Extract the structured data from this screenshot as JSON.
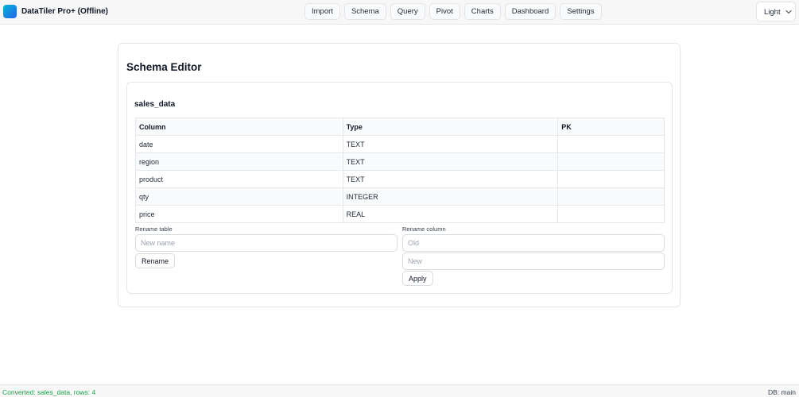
{
  "app": {
    "title": "DataTiler Pro+ (Offline)",
    "logo_icon": "app-logo-icon"
  },
  "nav": {
    "items": [
      "Import",
      "Schema",
      "Query",
      "Pivot",
      "Charts",
      "Dashboard",
      "Settings"
    ]
  },
  "theme_select": {
    "value": "Light",
    "icon": "chevron-down-icon"
  },
  "page": {
    "title": "Schema Editor"
  },
  "table": {
    "name": "sales_data",
    "headers": [
      "Column",
      "Type",
      "PK"
    ],
    "rows": [
      [
        "date",
        "TEXT",
        ""
      ],
      [
        "region",
        "TEXT",
        ""
      ],
      [
        "product",
        "TEXT",
        ""
      ],
      [
        "qty",
        "INTEGER",
        ""
      ],
      [
        "price",
        "REAL",
        ""
      ]
    ]
  },
  "rename_table": {
    "label": "Rename table",
    "placeholder": "New name",
    "value": "",
    "button": "Rename"
  },
  "rename_column": {
    "label": "Rename column",
    "old_placeholder": "Old",
    "new_placeholder": "New",
    "old_value": "",
    "new_value": "",
    "button": "Apply"
  },
  "status": {
    "message": "Converted: sales_data, rows: 4",
    "db": "DB: main"
  },
  "colors": {
    "status_ok": "#16a34a",
    "logo_start": "#06b6d4",
    "logo_end": "#2563eb"
  }
}
